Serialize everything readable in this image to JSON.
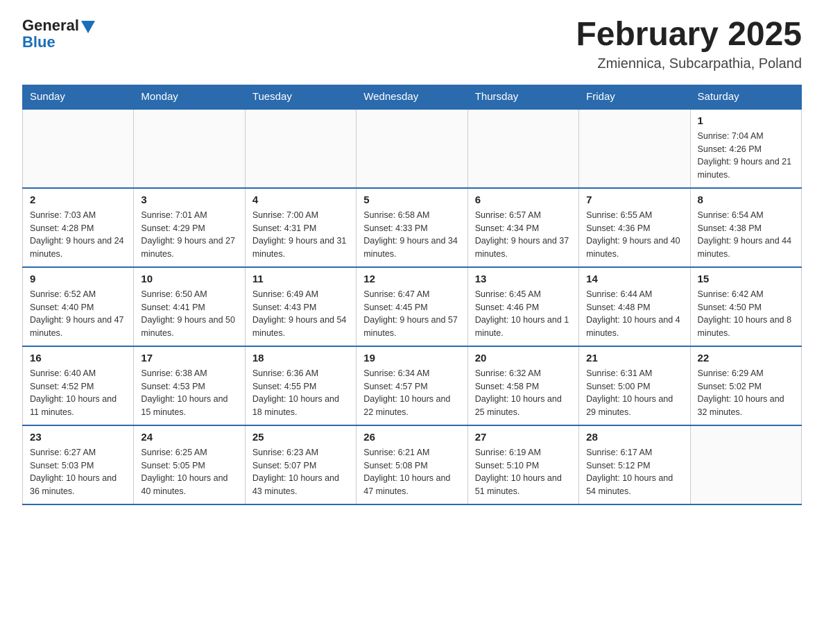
{
  "header": {
    "logo_general": "General",
    "logo_blue": "Blue",
    "month_title": "February 2025",
    "location": "Zmiennica, Subcarpathia, Poland"
  },
  "days_of_week": [
    "Sunday",
    "Monday",
    "Tuesday",
    "Wednesday",
    "Thursday",
    "Friday",
    "Saturday"
  ],
  "weeks": [
    [
      {
        "day": "",
        "info": ""
      },
      {
        "day": "",
        "info": ""
      },
      {
        "day": "",
        "info": ""
      },
      {
        "day": "",
        "info": ""
      },
      {
        "day": "",
        "info": ""
      },
      {
        "day": "",
        "info": ""
      },
      {
        "day": "1",
        "info": "Sunrise: 7:04 AM\nSunset: 4:26 PM\nDaylight: 9 hours and 21 minutes."
      }
    ],
    [
      {
        "day": "2",
        "info": "Sunrise: 7:03 AM\nSunset: 4:28 PM\nDaylight: 9 hours and 24 minutes."
      },
      {
        "day": "3",
        "info": "Sunrise: 7:01 AM\nSunset: 4:29 PM\nDaylight: 9 hours and 27 minutes."
      },
      {
        "day": "4",
        "info": "Sunrise: 7:00 AM\nSunset: 4:31 PM\nDaylight: 9 hours and 31 minutes."
      },
      {
        "day": "5",
        "info": "Sunrise: 6:58 AM\nSunset: 4:33 PM\nDaylight: 9 hours and 34 minutes."
      },
      {
        "day": "6",
        "info": "Sunrise: 6:57 AM\nSunset: 4:34 PM\nDaylight: 9 hours and 37 minutes."
      },
      {
        "day": "7",
        "info": "Sunrise: 6:55 AM\nSunset: 4:36 PM\nDaylight: 9 hours and 40 minutes."
      },
      {
        "day": "8",
        "info": "Sunrise: 6:54 AM\nSunset: 4:38 PM\nDaylight: 9 hours and 44 minutes."
      }
    ],
    [
      {
        "day": "9",
        "info": "Sunrise: 6:52 AM\nSunset: 4:40 PM\nDaylight: 9 hours and 47 minutes."
      },
      {
        "day": "10",
        "info": "Sunrise: 6:50 AM\nSunset: 4:41 PM\nDaylight: 9 hours and 50 minutes."
      },
      {
        "day": "11",
        "info": "Sunrise: 6:49 AM\nSunset: 4:43 PM\nDaylight: 9 hours and 54 minutes."
      },
      {
        "day": "12",
        "info": "Sunrise: 6:47 AM\nSunset: 4:45 PM\nDaylight: 9 hours and 57 minutes."
      },
      {
        "day": "13",
        "info": "Sunrise: 6:45 AM\nSunset: 4:46 PM\nDaylight: 10 hours and 1 minute."
      },
      {
        "day": "14",
        "info": "Sunrise: 6:44 AM\nSunset: 4:48 PM\nDaylight: 10 hours and 4 minutes."
      },
      {
        "day": "15",
        "info": "Sunrise: 6:42 AM\nSunset: 4:50 PM\nDaylight: 10 hours and 8 minutes."
      }
    ],
    [
      {
        "day": "16",
        "info": "Sunrise: 6:40 AM\nSunset: 4:52 PM\nDaylight: 10 hours and 11 minutes."
      },
      {
        "day": "17",
        "info": "Sunrise: 6:38 AM\nSunset: 4:53 PM\nDaylight: 10 hours and 15 minutes."
      },
      {
        "day": "18",
        "info": "Sunrise: 6:36 AM\nSunset: 4:55 PM\nDaylight: 10 hours and 18 minutes."
      },
      {
        "day": "19",
        "info": "Sunrise: 6:34 AM\nSunset: 4:57 PM\nDaylight: 10 hours and 22 minutes."
      },
      {
        "day": "20",
        "info": "Sunrise: 6:32 AM\nSunset: 4:58 PM\nDaylight: 10 hours and 25 minutes."
      },
      {
        "day": "21",
        "info": "Sunrise: 6:31 AM\nSunset: 5:00 PM\nDaylight: 10 hours and 29 minutes."
      },
      {
        "day": "22",
        "info": "Sunrise: 6:29 AM\nSunset: 5:02 PM\nDaylight: 10 hours and 32 minutes."
      }
    ],
    [
      {
        "day": "23",
        "info": "Sunrise: 6:27 AM\nSunset: 5:03 PM\nDaylight: 10 hours and 36 minutes."
      },
      {
        "day": "24",
        "info": "Sunrise: 6:25 AM\nSunset: 5:05 PM\nDaylight: 10 hours and 40 minutes."
      },
      {
        "day": "25",
        "info": "Sunrise: 6:23 AM\nSunset: 5:07 PM\nDaylight: 10 hours and 43 minutes."
      },
      {
        "day": "26",
        "info": "Sunrise: 6:21 AM\nSunset: 5:08 PM\nDaylight: 10 hours and 47 minutes."
      },
      {
        "day": "27",
        "info": "Sunrise: 6:19 AM\nSunset: 5:10 PM\nDaylight: 10 hours and 51 minutes."
      },
      {
        "day": "28",
        "info": "Sunrise: 6:17 AM\nSunset: 5:12 PM\nDaylight: 10 hours and 54 minutes."
      },
      {
        "day": "",
        "info": ""
      }
    ]
  ]
}
